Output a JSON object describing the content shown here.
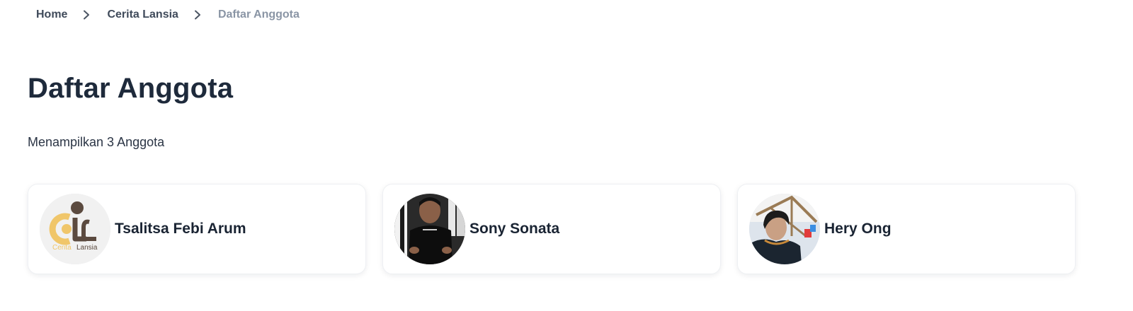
{
  "breadcrumb": {
    "items": [
      {
        "label": "Home",
        "current": false
      },
      {
        "label": "Cerita Lansia",
        "current": false
      },
      {
        "label": "Daftar Anggota",
        "current": true
      }
    ],
    "separator_icon": "chevron-right-icon"
  },
  "page": {
    "title": "Daftar Anggota",
    "count_text": "Menampilkan 3 Anggota"
  },
  "members": [
    {
      "name": "Tsalitsa Febi Arum",
      "avatar": "cerita-lansia-logo",
      "logo_text_1": "Cerita",
      "logo_text_2": "Lansia"
    },
    {
      "name": "Sony Sonata",
      "avatar": "profile-photo"
    },
    {
      "name": "Hery Ong",
      "avatar": "profile-photo"
    }
  ],
  "colors": {
    "title": "#1e2a3b",
    "breadcrumb": "#3f4a5a",
    "breadcrumb_current": "#8a95a5",
    "logo_gold": "#f0c66a",
    "logo_brown": "#5b4a3f"
  }
}
